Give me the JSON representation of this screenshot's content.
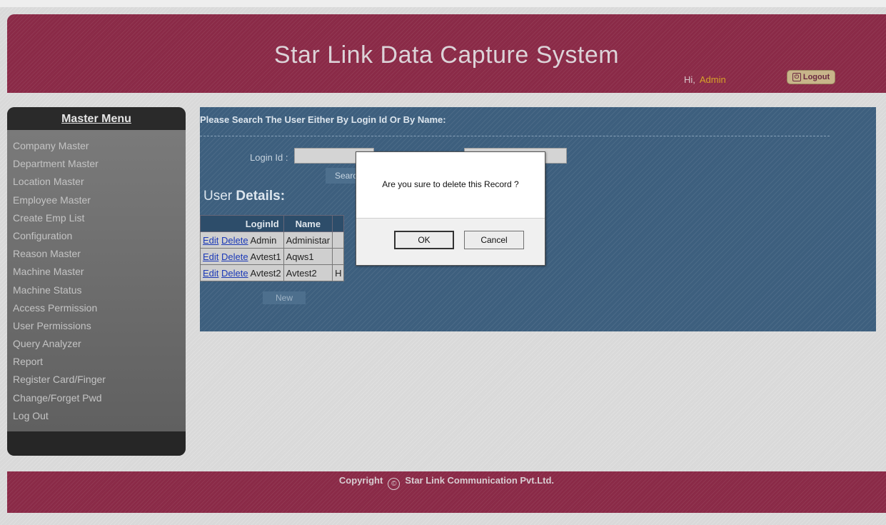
{
  "header": {
    "title": "Star Link Data Capture System",
    "greeting": "Hi,",
    "user": "Admin",
    "logout_label": "Logout",
    "logout_icon": "power-icon"
  },
  "sidebar": {
    "title": "Master Menu",
    "items": [
      {
        "label": "Company Master"
      },
      {
        "label": "Department Master"
      },
      {
        "label": "Location Master"
      },
      {
        "label": "Employee Master"
      },
      {
        "label": "Create Emp List"
      },
      {
        "label": "Configuration"
      },
      {
        "label": "Reason Master"
      },
      {
        "label": "Machine Master"
      },
      {
        "label": "Machine Status"
      },
      {
        "label": "Access Permission"
      },
      {
        "label": "User Permissions"
      },
      {
        "label": "Query Analyzer"
      },
      {
        "label": "Report"
      },
      {
        "label": "Register Card/Finger"
      },
      {
        "label": "Change/Forget Pwd"
      },
      {
        "label": "Log Out"
      }
    ]
  },
  "main": {
    "prompt": "Please Search The User Either By Login Id Or By Name:",
    "login_label": "Login Id :",
    "login_value": "",
    "name_value": "",
    "search_label": "Search",
    "details_prefix": "User ",
    "details_bold": "Details:",
    "table": {
      "headers": [
        "LoginId",
        "Name",
        ""
      ],
      "rows": [
        {
          "edit": "Edit",
          "delete": "Delete",
          "login": "Admin",
          "name": "Administar",
          "extra": ""
        },
        {
          "edit": "Edit",
          "delete": "Delete",
          "login": "Avtest1",
          "name": "Aqws1",
          "extra": ""
        },
        {
          "edit": "Edit",
          "delete": "Delete",
          "login": "Avtest2",
          "name": "Avtest2",
          "extra": "H"
        }
      ]
    },
    "new_label": "New"
  },
  "dialog": {
    "message": "Are you sure to delete this Record ?",
    "ok_label": "OK",
    "cancel_label": "Cancel"
  },
  "footer": {
    "copyright_label": "Copyright",
    "copyright_symbol": "©",
    "company": "Star Link Communication Pvt.Ltd."
  }
}
